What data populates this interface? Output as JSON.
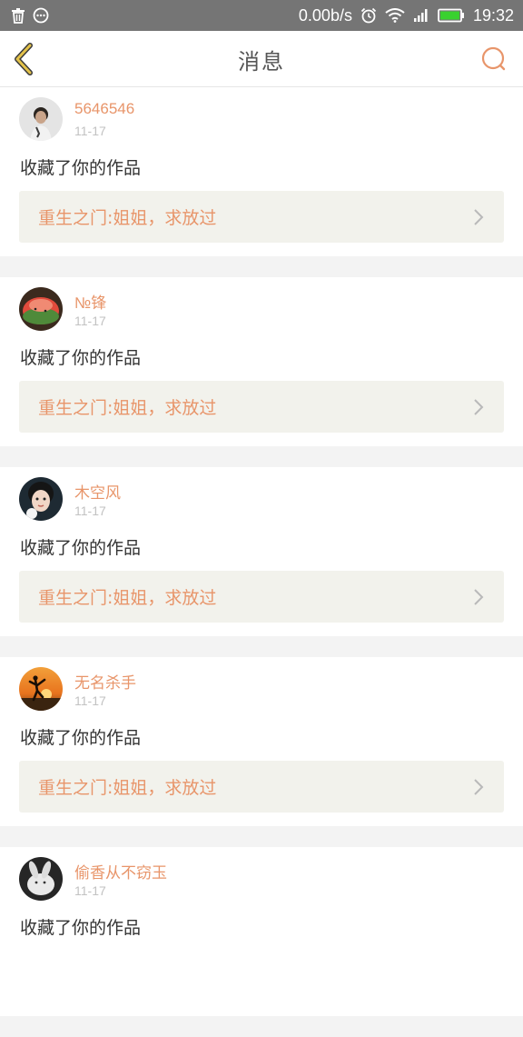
{
  "status_bar": {
    "network_speed": "0.00b/s",
    "time": "19:32",
    "icons": [
      "trash-icon",
      "chat-bubble-icon",
      "alarm-icon",
      "wifi-icon",
      "signal-icon",
      "battery-icon"
    ]
  },
  "nav": {
    "title": "消息",
    "back_icon": "chevron-left-icon",
    "search_icon": "search-icon"
  },
  "colors": {
    "accent": "#e8956a",
    "back_icon": "#d9b640",
    "status_bar_bg": "#757575",
    "link_bg": "#f2f2ec"
  },
  "messages": [
    {
      "user": "5646546",
      "date": "11-17",
      "action": "收藏了你的作品",
      "work": "重生之门:姐姐，求放过"
    },
    {
      "user": "№锋",
      "date": "11-17",
      "action": "收藏了你的作品",
      "work": "重生之门:姐姐，求放过"
    },
    {
      "user": "木空风",
      "date": "11-17",
      "action": "收藏了你的作品",
      "work": "重生之门:姐姐，求放过"
    },
    {
      "user": "无名杀手",
      "date": "11-17",
      "action": "收藏了你的作品",
      "work": "重生之门:姐姐，求放过"
    },
    {
      "user": "偷香从不窃玉",
      "date": "11-17",
      "action": "收藏了你的作品",
      "work": ""
    }
  ]
}
